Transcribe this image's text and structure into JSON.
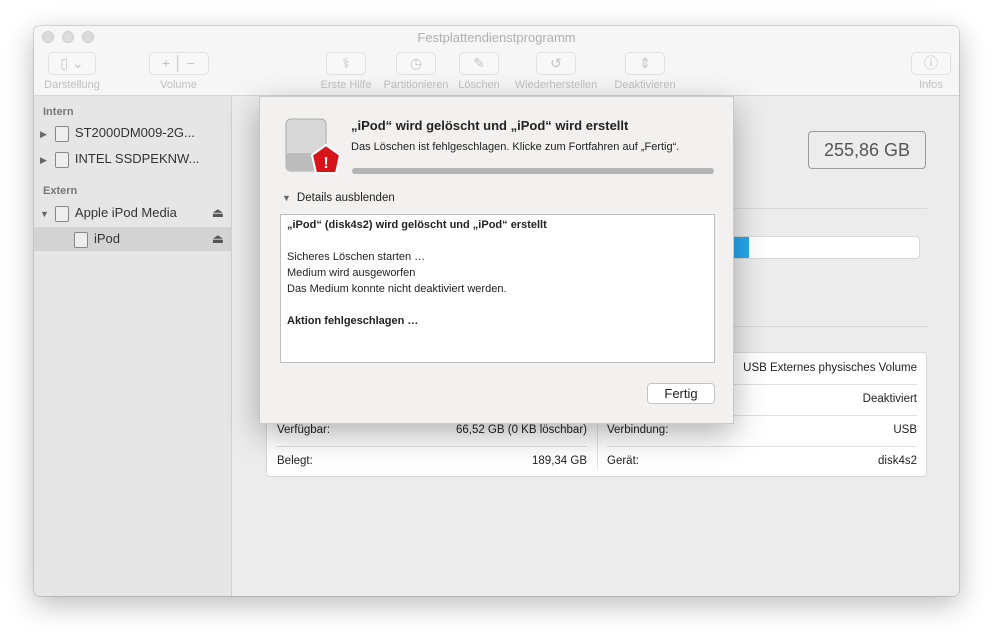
{
  "window": {
    "title": "Festplattendienstprogramm"
  },
  "toolbar": {
    "view": "Darstellung",
    "volume": "Volume",
    "first_aid": "Erste Hilfe",
    "partition": "Partitionieren",
    "erase": "Löschen",
    "restore": "Wiederherstellen",
    "unmount": "Deaktivieren",
    "info": "Infos"
  },
  "sidebar": {
    "internal_header": "Intern",
    "external_header": "Extern",
    "items": [
      {
        "label": "ST2000DM009-2G..."
      },
      {
        "label": "INTEL SSDPEKNW..."
      },
      {
        "label": "Apple iPod Media"
      },
      {
        "label": "iPod"
      }
    ]
  },
  "main": {
    "capacity": "255,86 GB",
    "usage_fraction": 0.74,
    "usage_color": "#27a9f1",
    "info_left": [
      {
        "label": "Verfügbar:",
        "value": "66,52 GB (0 KB löschbar)"
      },
      {
        "label": "Belegt:",
        "value": "189,34 GB"
      }
    ],
    "info_right": [
      {
        "label": "",
        "value": "USB Externes physisches Volume"
      },
      {
        "label": "",
        "value": "Deaktiviert"
      },
      {
        "label": "Verbindung:",
        "value": "USB"
      },
      {
        "label": "Gerät:",
        "value": "disk4s2"
      }
    ]
  },
  "dialog": {
    "title": "„iPod“ wird gelöscht und „iPod“ wird erstellt",
    "message": "Das Löschen ist fehlgeschlagen. Klicke zum Fortfahren auf „Fertig“.",
    "progress": 1.0,
    "details_toggle": "Details ausblenden",
    "log": [
      "„iPod“ (disk4s2) wird gelöscht und „iPod“ erstellt",
      "",
      "Sicheres Löschen starten …",
      "Medium wird ausgeworfen",
      "Das Medium konnte nicht deaktiviert werden.",
      "",
      "Aktion fehlgeschlagen …"
    ],
    "done_button": "Fertig"
  }
}
